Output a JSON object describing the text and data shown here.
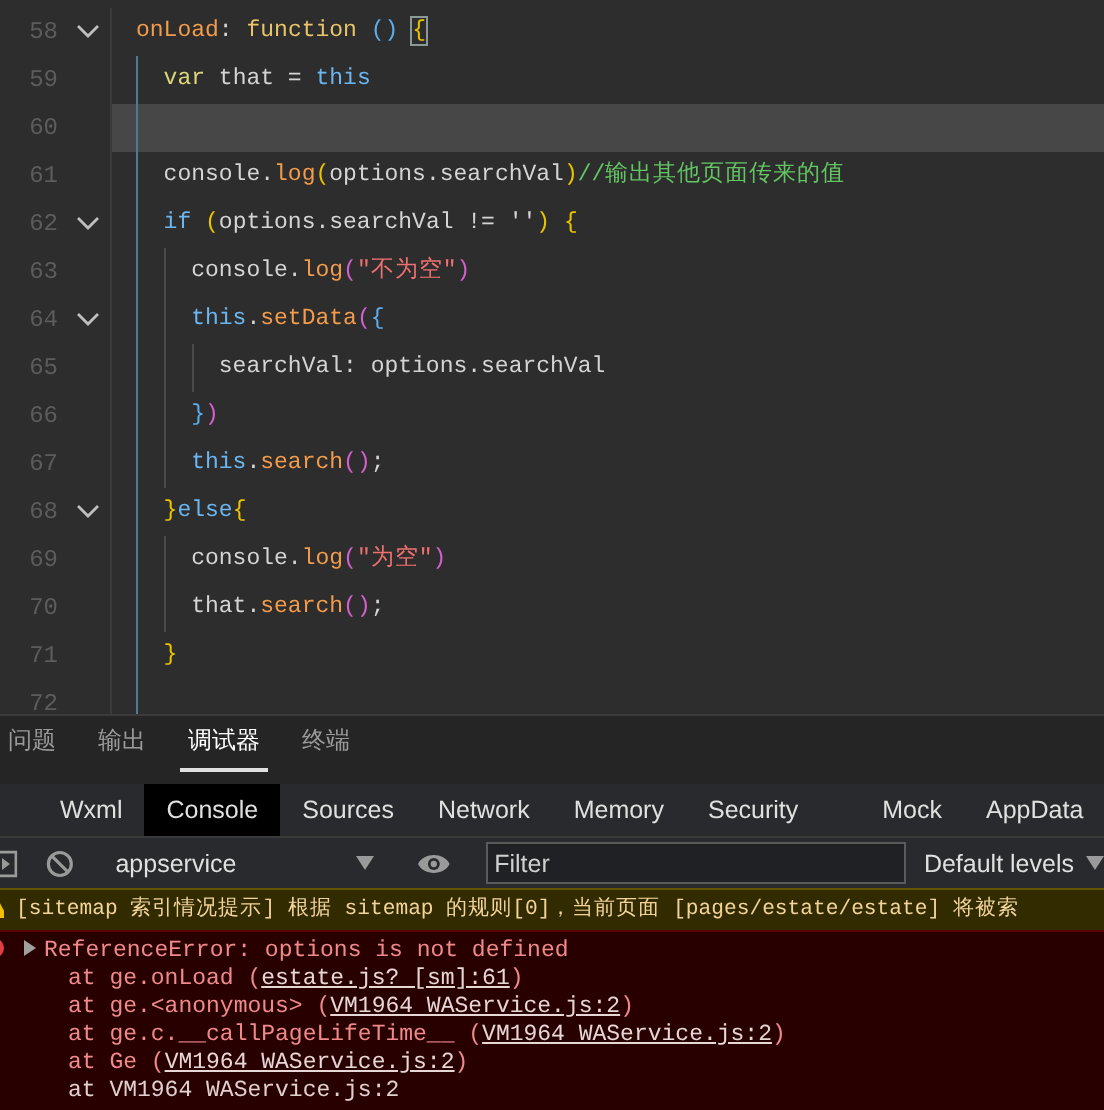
{
  "editor": {
    "lines": [
      {
        "number": "58",
        "fold": true,
        "current": false,
        "tokens": [
          {
            "t": "onLoad",
            "kind": "prop"
          },
          {
            "t": ": ",
            "kind": "plain"
          },
          {
            "t": "function ",
            "kind": "fn"
          },
          {
            "t": "() ",
            "kind": "b3"
          },
          {
            "t": "{",
            "kind": "b1",
            "caret": true
          }
        ]
      },
      {
        "number": "59",
        "fold": false,
        "current": false,
        "tokens": [
          {
            "t": "  var",
            "kind": "var"
          },
          {
            "t": " that = ",
            "kind": "plain"
          },
          {
            "t": "this",
            "kind": "this"
          }
        ]
      },
      {
        "number": "60",
        "fold": false,
        "current": true
      },
      {
        "number": "61",
        "fold": false,
        "current": false,
        "tokens": [
          {
            "t": "  console.",
            "kind": "plain"
          },
          {
            "t": "log",
            "kind": "call"
          },
          {
            "t": "(",
            "kind": "b1"
          },
          {
            "t": "options.searchVal",
            "kind": "plain"
          },
          {
            "t": ")",
            "kind": "b1"
          },
          {
            "t": "//输出其他页面传来的值",
            "kind": "cmt"
          }
        ]
      },
      {
        "number": "62",
        "fold": true,
        "current": false,
        "tokens": [
          {
            "t": "  if ",
            "kind": "this"
          },
          {
            "t": "(",
            "kind": "b1"
          },
          {
            "t": "options.searchVal != ''",
            "kind": "plain"
          },
          {
            "t": ") {",
            "kind": "b1"
          }
        ]
      },
      {
        "number": "63",
        "fold": false,
        "current": false,
        "tokens": [
          {
            "t": "    console.",
            "kind": "plain"
          },
          {
            "t": "log",
            "kind": "call"
          },
          {
            "t": "(",
            "kind": "b2"
          },
          {
            "t": "\"不为空\"",
            "kind": "str"
          },
          {
            "t": ")",
            "kind": "b2"
          }
        ]
      },
      {
        "number": "64",
        "fold": true,
        "current": false,
        "tokens": [
          {
            "t": "    this",
            "kind": "this"
          },
          {
            "t": ".",
            "kind": "plain"
          },
          {
            "t": "setData",
            "kind": "call"
          },
          {
            "t": "(",
            "kind": "b2"
          },
          {
            "t": "{",
            "kind": "b3"
          }
        ]
      },
      {
        "number": "65",
        "fold": false,
        "current": false,
        "tokens": [
          {
            "t": "      searchVal: options.searchVal",
            "kind": "plain"
          }
        ]
      },
      {
        "number": "66",
        "fold": false,
        "current": false,
        "tokens": [
          {
            "t": "    }",
            "kind": "b3"
          },
          {
            "t": ")",
            "kind": "b2"
          }
        ]
      },
      {
        "number": "67",
        "fold": false,
        "current": false,
        "tokens": [
          {
            "t": "    this",
            "kind": "this"
          },
          {
            "t": ".",
            "kind": "plain"
          },
          {
            "t": "search",
            "kind": "call"
          },
          {
            "t": "()",
            "kind": "b2"
          },
          {
            "t": ";",
            "kind": "plain"
          }
        ]
      },
      {
        "number": "68",
        "fold": true,
        "current": false,
        "tokens": [
          {
            "t": "  }",
            "kind": "b1"
          },
          {
            "t": "else",
            "kind": "this"
          },
          {
            "t": "{",
            "kind": "b1"
          }
        ]
      },
      {
        "number": "69",
        "fold": false,
        "current": false,
        "tokens": [
          {
            "t": "    console.",
            "kind": "plain"
          },
          {
            "t": "log",
            "kind": "call"
          },
          {
            "t": "(",
            "kind": "b2"
          },
          {
            "t": "\"为空\"",
            "kind": "str"
          },
          {
            "t": ")",
            "kind": "b2"
          }
        ]
      },
      {
        "number": "70",
        "fold": false,
        "current": false,
        "tokens": [
          {
            "t": "    that.",
            "kind": "plain"
          },
          {
            "t": "search",
            "kind": "call"
          },
          {
            "t": "()",
            "kind": "b2"
          },
          {
            "t": ";",
            "kind": "plain"
          }
        ]
      },
      {
        "number": "71",
        "fold": false,
        "current": false,
        "tokens": [
          {
            "t": "  }",
            "kind": "b1"
          }
        ]
      },
      {
        "number": "72",
        "fold": false,
        "current": false
      }
    ]
  },
  "panel_tabs": [
    {
      "label": "问题",
      "selected": false
    },
    {
      "label": "输出",
      "selected": false
    },
    {
      "label": "调试器",
      "selected": true
    },
    {
      "label": "终端",
      "selected": false
    }
  ],
  "devtools_tabs": [
    {
      "label": "Wxml",
      "selected": false
    },
    {
      "label": "Console",
      "selected": true
    },
    {
      "label": "Sources",
      "selected": false
    },
    {
      "label": "Network",
      "selected": false
    },
    {
      "label": "Memory",
      "selected": false
    },
    {
      "label": "Security",
      "selected": false
    },
    {
      "label": "Mock",
      "selected": false
    },
    {
      "label": "AppData",
      "selected": false
    }
  ],
  "console_toolbar": {
    "context": "appservice",
    "filter": {
      "placeholder": "Filter"
    },
    "levels": "Default levels"
  },
  "messages": [
    {
      "kind": "warning",
      "text": "[sitemap 索引情况提示] 根据 sitemap 的规则[0]，当前页面 [pages/estate/estate] 将被索"
    },
    {
      "kind": "error",
      "text": "ReferenceError: options is not defined",
      "stack": [
        {
          "prefix": "at ge.onLoad (",
          "link": "estate.js? [sm]:61",
          "suffix": ")"
        },
        {
          "prefix": "at ge.<anonymous> (",
          "link": "VM1964 WAService.js:2",
          "suffix": ")"
        },
        {
          "prefix": "at ge.c.__callPageLifeTime__ (",
          "link": "VM1964 WAService.js:2",
          "suffix": ")"
        },
        {
          "prefix": "at Ge (",
          "link": "VM1964 WAService.js:2",
          "suffix": ")"
        },
        {
          "prefix": "at VM1964 WAService.js:2"
        }
      ]
    }
  ]
}
